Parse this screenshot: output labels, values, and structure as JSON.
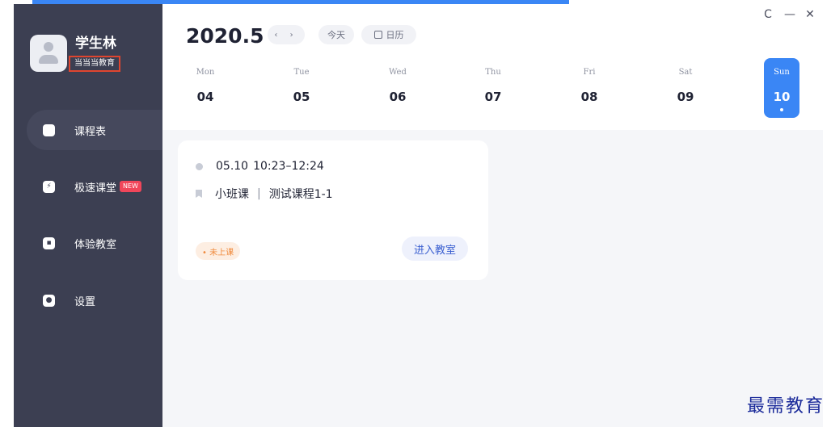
{
  "user": {
    "name": "学生林",
    "org": "当当当教育"
  },
  "nav": [
    {
      "label": "课程表",
      "badge": ""
    },
    {
      "label": "极速课堂",
      "badge": "NEW"
    },
    {
      "label": "体验教室",
      "badge": ""
    },
    {
      "label": "设置",
      "badge": ""
    }
  ],
  "header": {
    "title": "2020.5",
    "prev_next": "‹ ›",
    "today_label": "今天",
    "calendar_label": "日历"
  },
  "window": {
    "refresh": "C",
    "minimize": "—",
    "close": "✕"
  },
  "week": [
    {
      "name": "Mon",
      "date": "04"
    },
    {
      "name": "Tue",
      "date": "05"
    },
    {
      "name": "Wed",
      "date": "06"
    },
    {
      "name": "Thu",
      "date": "07"
    },
    {
      "name": "Fri",
      "date": "08"
    },
    {
      "name": "Sat",
      "date": "09"
    },
    {
      "name": "Sun",
      "date": "10",
      "selected": true
    }
  ],
  "lesson": {
    "date": "05.10",
    "time": "10:23–12:24",
    "type": "小班课",
    "separator": "|",
    "name": "测试课程1-1",
    "status": "• 未上课",
    "action_label": "进入教室"
  },
  "watermark": "最需教育",
  "colors": {
    "accent": "#3a86f5",
    "sidebar": "#3c3f52",
    "badge_new": "#f0465a",
    "status": "#f08a3c"
  }
}
